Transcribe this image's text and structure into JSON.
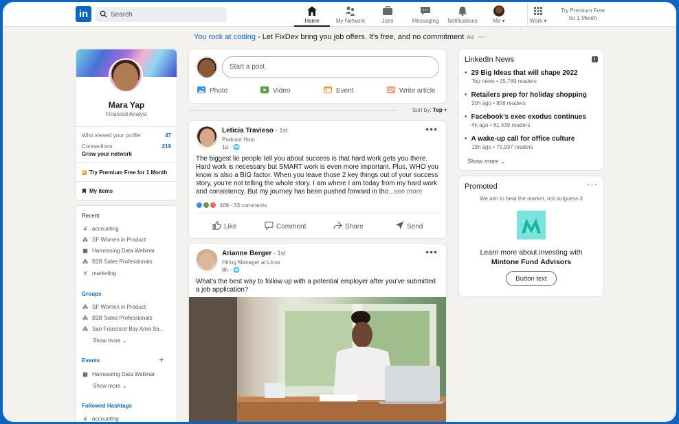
{
  "nav": {
    "logo": "in",
    "search_placeholder": "Search",
    "items": [
      {
        "label": "Home",
        "icon": "home-icon"
      },
      {
        "label": "My Network",
        "icon": "network-icon"
      },
      {
        "label": "Jobs",
        "icon": "briefcase-icon"
      },
      {
        "label": "Messaging",
        "icon": "message-icon"
      },
      {
        "label": "Notifications",
        "icon": "bell-icon"
      },
      {
        "label": "Me",
        "icon": "avatar"
      },
      {
        "label": "Work",
        "icon": "grid-icon"
      }
    ],
    "premium": "Try Premium Free for 1 Month",
    "active_item": "Home"
  },
  "ad": {
    "highlight": "You rock at coding",
    "text": " - Let FixDex bring you job offers. It's free, and no commitment",
    "badge": "Ad",
    "menu": "···"
  },
  "profile": {
    "name": "Mara Yap",
    "title": "Financial Analyst",
    "viewed_label": "Who viewed your profile",
    "viewed_value": "47",
    "connections_label": "Connections",
    "connections_value": "219",
    "grow": "Grow your network",
    "premium": "Try Premium Free for 1 Month",
    "my_items": "My items"
  },
  "sidebar": {
    "recent_heading": "Recent",
    "recent": [
      {
        "label": "accounting",
        "icon": "hashtag-icon"
      },
      {
        "label": "SF Women in Product",
        "icon": "group-icon"
      },
      {
        "label": "Harnessing Data Webinar",
        "icon": "calendar-icon"
      },
      {
        "label": "B2B Sales Professionals",
        "icon": "group-icon"
      },
      {
        "label": "marketing",
        "icon": "hashtag-icon"
      }
    ],
    "groups_heading": "Groups",
    "groups": [
      {
        "label": "SF Women in Product"
      },
      {
        "label": "B2B Sales Professionals"
      },
      {
        "label": "San Francisco Bay Area Sa..."
      }
    ],
    "show_more": "Show more",
    "events_heading": "Events",
    "events": [
      {
        "label": "Harnessing Data Webinar"
      }
    ],
    "hashtags_heading": "Followed Hashtags",
    "hashtags": [
      {
        "label": "accounting"
      }
    ]
  },
  "share": {
    "placeholder": "Start a post",
    "actions": [
      {
        "label": "Photo",
        "color": "#378fe9"
      },
      {
        "label": "Video",
        "color": "#5f9b41"
      },
      {
        "label": "Event",
        "color": "#e16745"
      },
      {
        "label": "Write article",
        "color": "#e06847"
      }
    ]
  },
  "sort": {
    "label": "Sort by:",
    "value": "Top"
  },
  "posts": [
    {
      "author": "Leticia Travieso",
      "degree": "· 1st",
      "subtitle": "Podcast Host",
      "time": "1d · 🌐",
      "body": "The biggest lie people tell you about success is that hard work gets you there. Hard work is necessary but SMART work is even more important. Plus, WHO you know is also a BIG factor. When you leave those 2 key things out of your success story, you're not telling the whole story. I am where I am today from my hard work and consistency. But my journey has been pushed forward in tho",
      "see_more": "...see more",
      "reactions": "468",
      "comments": "· 33 comments",
      "actions": [
        "Like",
        "Comment",
        "Share",
        "Send"
      ]
    },
    {
      "author": "Arianne Berger",
      "degree": "· 1st",
      "subtitle": "Hiring Manager at Linux",
      "time": "8h · 🌐",
      "body": "What's the best way to follow up with a potential employer after you've submitted a job application?"
    }
  ],
  "news": {
    "title": "LinkedIn News",
    "items": [
      {
        "headline": "29 Big Ideas that will shape 2022",
        "meta": "Top news • 25,789 readers"
      },
      {
        "headline": "Retailers prep for holiday shopping",
        "meta": "20h ago • 858 readers"
      },
      {
        "headline": "Facebook's exec exodus continues",
        "meta": "4h ago • 61,439 readers"
      },
      {
        "headline": "A wake-up call for office culture",
        "meta": "19h ago • 75,937 readers"
      }
    ],
    "show_more": "Show more"
  },
  "promoted": {
    "title": "Promoted",
    "tagline": "We aim to beat the market, not outguess it",
    "line1": "Learn more about investing with",
    "line2": "Mintone Fund Advisors",
    "button": "Button text",
    "logo_color": "#7de3dd"
  }
}
